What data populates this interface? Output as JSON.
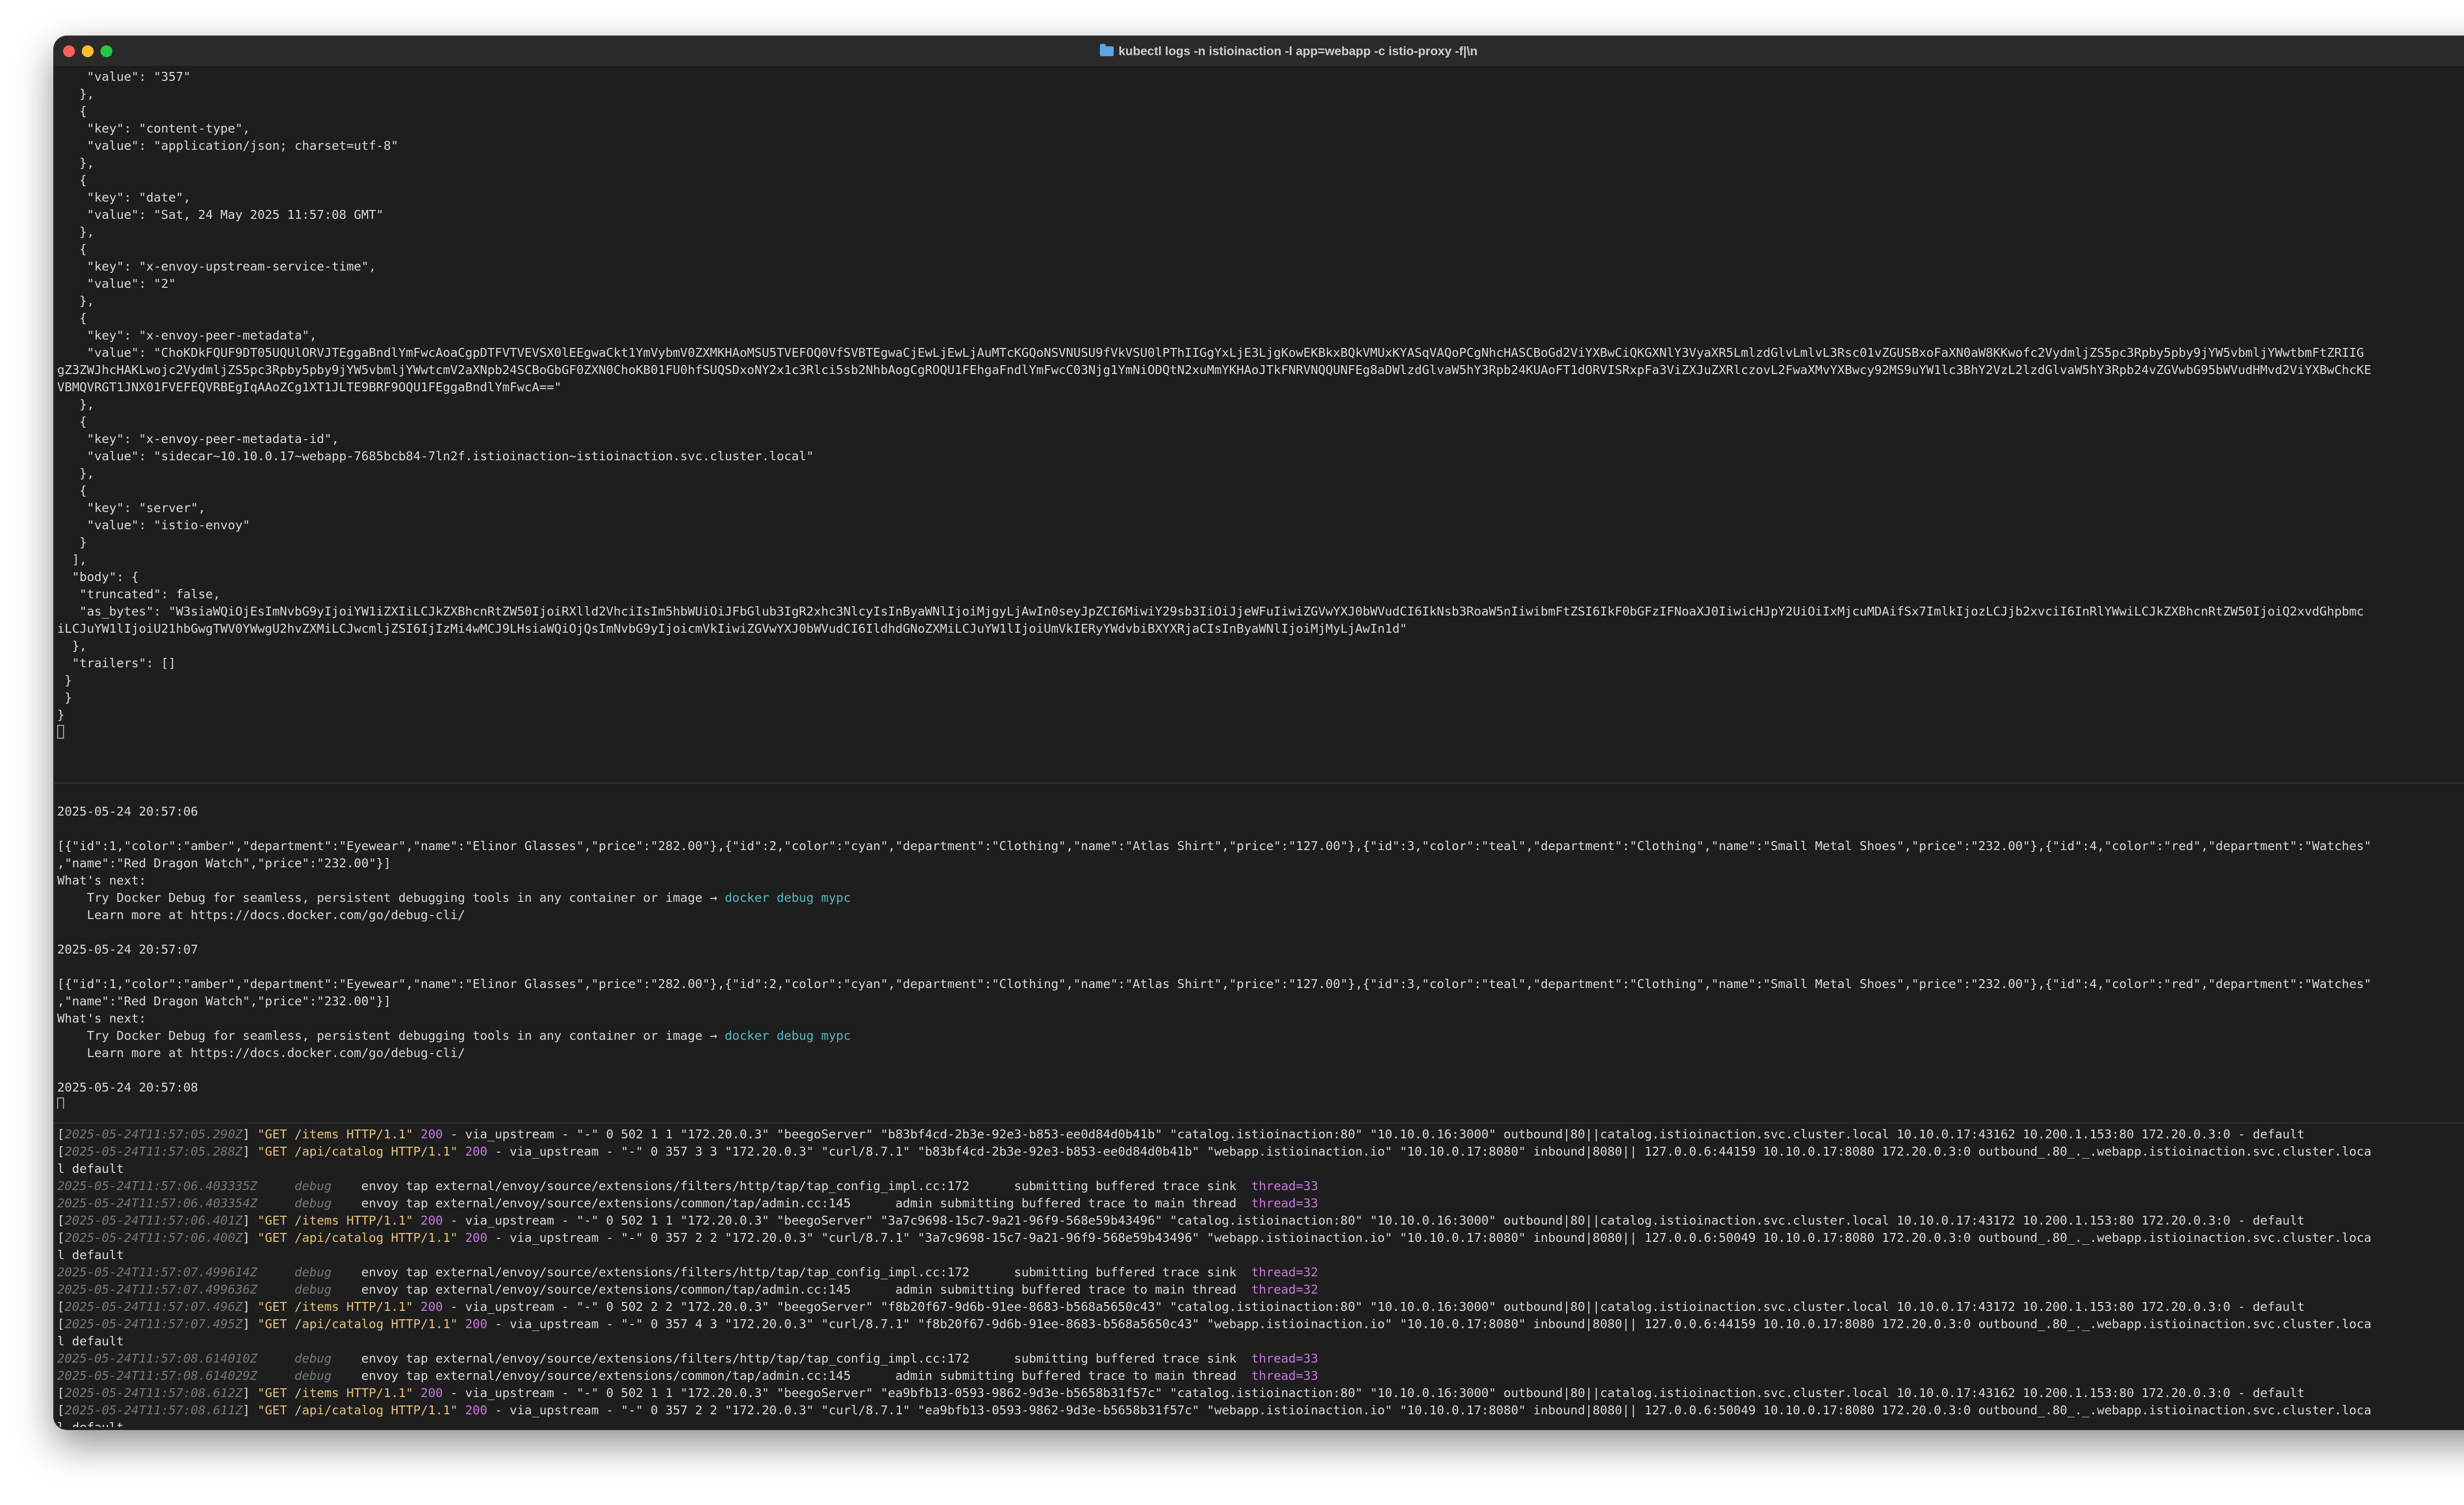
{
  "window": {
    "title": "kubectl logs -n istioinaction -l app=webapp -c istio-proxy -f|\\n",
    "icon": "folder-icon"
  },
  "json_output_lines": [
    "    \"value\": \"357\"",
    "   },",
    "   {",
    "    \"key\": \"content-type\",",
    "    \"value\": \"application/json; charset=utf-8\"",
    "   },",
    "   {",
    "    \"key\": \"date\",",
    "    \"value\": \"Sat, 24 May 2025 11:57:08 GMT\"",
    "   },",
    "   {",
    "    \"key\": \"x-envoy-upstream-service-time\",",
    "    \"value\": \"2\"",
    "   },",
    "   {",
    "    \"key\": \"x-envoy-peer-metadata\",",
    "    \"value\": \"ChoKDkFQUF9DT05UQUlORVJTEggaBndlYmFwcAoaCgpDTFVTVEVSX0lEEgwaCkt1YmVybmV0ZXMKHAoMSU5TVEFOQ0VfSVBTEgwaCjEwLjEwLjAuMTcKGQoNSVNUSU9fVkVSU0lPThIIGgYxLjE3LjgKowEKBkxBQkVMUxKYASqVAQoPCgNhcHASCBoGd2ViYXBwCiQKGXNlY3VyaXR5LmlzdGlvLmlvL3Rsc01vZGUSBxoFaXN0aW8KKwofc2VydmljZS5pc3Rpby5pby9jYW5vbmljYWwtbmFtZRIIG",
    "gZ3ZWJhcHAKLwojc2VydmljZS5pc3Rpby5pby9jYW5vbmljYWwtcmV2aXNpb24SCBoGbGF0ZXN0ChoKB01FU0hfSUQSDxoNY2x1c3Rlci5sb2NhbAogCgROQU1FEhgaFndlYmFwcC03Njg1YmNiODQtN2xuMmYKHAoJTkFNRVNQQUNFEg8aDWlzdGlvaW5hY3Rpb24KUAoFT1dORVISRxpFa3ViZXJuZXRlczovL2FwaXMvYXBwcy92MS9uYW1lc3BhY2VzL2lzdGlvaW5hY3Rpb24vZGVwbG95bWVudHMvd2ViYXBwChcKE",
    "VBMQVRGT1JNX01FVEFEQVRBEgIqAAoZCg1XT1JLTE9BRF9OQU1FEggaBndlYmFwcA==\"",
    "   },",
    "   {",
    "    \"key\": \"x-envoy-peer-metadata-id\",",
    "    \"value\": \"sidecar~10.10.0.17~webapp-7685bcb84-7ln2f.istioinaction~istioinaction.svc.cluster.local\"",
    "   },",
    "   {",
    "    \"key\": \"server\",",
    "    \"value\": \"istio-envoy\"",
    "   }",
    "  ],",
    "  \"body\": {",
    "   \"truncated\": false,",
    "   \"as_bytes\": \"W3siaWQiOjEsImNvbG9yIjoiYW1iZXIiLCJkZXBhcnRtZW50IjoiRXlld2VhciIsIm5hbWUiOiJFbGlub3IgR2xhc3NlcyIsInByaWNlIjoiMjgyLjAwIn0seyJpZCI6MiwiY29sb3IiOiJjeWFuIiwiZGVwYXJ0bWVudCI6IkNsb3RoaW5nIiwibmFtZSI6IkF0bGFzIFNoaXJ0IiwicHJpY2UiOiIxMjcuMDAifSx7ImlkIjozLCJjb2xvciI6InRlYWwiLCJkZXBhcnRtZW50IjoiQ2xvdGhpbmc",
    "iLCJuYW1lIjoiU21hbGwgTWV0YWwgU2hvZXMiLCJwcmljZSI6IjIzMi4wMCJ9LHsiaWQiOjQsImNvbG9yIjoicmVkIiwiZGVwYXJ0bWVudCI6IldhdGNoZXMiLCJuYW1lIjoiUmVkIERyYWdvbiBXYXRjaCIsInByaWNlIjoiMjMyLjAwIn1d\"",
    "  },",
    "  \"trailers\": []",
    " }",
    " }",
    "}"
  ],
  "curl_pane": {
    "blocks": [
      {
        "timestamp": "2025-05-24 20:57:06",
        "response_line1": "[{\"id\":1,\"color\":\"amber\",\"department\":\"Eyewear\",\"name\":\"Elinor Glasses\",\"price\":\"282.00\"},{\"id\":2,\"color\":\"cyan\",\"department\":\"Clothing\",\"name\":\"Atlas Shirt\",\"price\":\"127.00\"},{\"id\":3,\"color\":\"teal\",\"department\":\"Clothing\",\"name\":\"Small Metal Shoes\",\"price\":\"232.00\"},{\"id\":4,\"color\":\"red\",\"department\":\"Watches\"",
        "response_line2": ",\"name\":\"Red Dragon Watch\",\"price\":\"232.00\"}]",
        "whats_next": "What's next:",
        "tip": "    Try Docker Debug for seamless, persistent debugging tools in any container or image → ",
        "tip_cmd": "docker debug mypc",
        "learn": "    Learn more at https://docs.docker.com/go/debug-cli/"
      },
      {
        "timestamp": "2025-05-24 20:57:07",
        "response_line1": "[{\"id\":1,\"color\":\"amber\",\"department\":\"Eyewear\",\"name\":\"Elinor Glasses\",\"price\":\"282.00\"},{\"id\":2,\"color\":\"cyan\",\"department\":\"Clothing\",\"name\":\"Atlas Shirt\",\"price\":\"127.00\"},{\"id\":3,\"color\":\"teal\",\"department\":\"Clothing\",\"name\":\"Small Metal Shoes\",\"price\":\"232.00\"},{\"id\":4,\"color\":\"red\",\"department\":\"Watches\"",
        "response_line2": ",\"name\":\"Red Dragon Watch\",\"price\":\"232.00\"}]",
        "whats_next": "What's next:",
        "tip": "    Try Docker Debug for seamless, persistent debugging tools in any container or image → ",
        "tip_cmd": "docker debug mypc",
        "learn": "    Learn more at https://docs.docker.com/go/debug-cli/"
      }
    ],
    "last_timestamp": "2025-05-24 20:57:08"
  },
  "log_pane": {
    "lines": [
      {
        "kind": "access",
        "ts": "2025-05-24T11:57:05.290Z",
        "req": "\"GET /items HTTP/1.1\"",
        "status": "200",
        "rest": " - via_upstream - \"-\" 0 502 1 1 \"172.20.0.3\" \"beegoServer\" \"b83bf4cd-2b3e-92e3-b853-ee0d84d0b41b\" \"catalog.istioinaction:80\" \"10.10.0.16:3000\" outbound|80||catalog.istioinaction.svc.cluster.local 10.10.0.17:43162 10.200.1.153:80 172.20.0.3:0 - default"
      },
      {
        "kind": "access",
        "ts": "2025-05-24T11:57:05.288Z",
        "req": "\"GET /api/catalog HTTP/1.1\"",
        "status": "200",
        "rest": " - via_upstream - \"-\" 0 357 3 3 \"172.20.0.3\" \"curl/8.7.1\" \"b83bf4cd-2b3e-92e3-b853-ee0d84d0b41b\" \"webapp.istioinaction.io\" \"10.10.0.17:8080\" inbound|8080|| 127.0.0.6:44159 10.10.0.17:8080 172.20.0.3:0 outbound_.80_._.webapp.istioinaction.svc.cluster.loca"
      },
      {
        "kind": "cont",
        "text": "l default"
      },
      {
        "kind": "debug",
        "ts": "2025-05-24T11:57:06.403335Z",
        "level": "debug",
        "msg": "envoy tap external/envoy/source/extensions/filters/http/tap/tap_config_impl.cc:172      submitting buffered trace sink  ",
        "thread": "thread=33"
      },
      {
        "kind": "debug",
        "ts": "2025-05-24T11:57:06.403354Z",
        "level": "debug",
        "msg": "envoy tap external/envoy/source/extensions/common/tap/admin.cc:145      admin submitting buffered trace to main thread  ",
        "thread": "thread=33"
      },
      {
        "kind": "access",
        "ts": "2025-05-24T11:57:06.401Z",
        "req": "\"GET /items HTTP/1.1\"",
        "status": "200",
        "rest": " - via_upstream - \"-\" 0 502 1 1 \"172.20.0.3\" \"beegoServer\" \"3a7c9698-15c7-9a21-96f9-568e59b43496\" \"catalog.istioinaction:80\" \"10.10.0.16:3000\" outbound|80||catalog.istioinaction.svc.cluster.local 10.10.0.17:43172 10.200.1.153:80 172.20.0.3:0 - default"
      },
      {
        "kind": "access",
        "ts": "2025-05-24T11:57:06.400Z",
        "req": "\"GET /api/catalog HTTP/1.1\"",
        "status": "200",
        "rest": " - via_upstream - \"-\" 0 357 2 2 \"172.20.0.3\" \"curl/8.7.1\" \"3a7c9698-15c7-9a21-96f9-568e59b43496\" \"webapp.istioinaction.io\" \"10.10.0.17:8080\" inbound|8080|| 127.0.0.6:50049 10.10.0.17:8080 172.20.0.3:0 outbound_.80_._.webapp.istioinaction.svc.cluster.loca"
      },
      {
        "kind": "cont",
        "text": "l default"
      },
      {
        "kind": "debug",
        "ts": "2025-05-24T11:57:07.499614Z",
        "level": "debug",
        "msg": "envoy tap external/envoy/source/extensions/filters/http/tap/tap_config_impl.cc:172      submitting buffered trace sink  ",
        "thread": "thread=32"
      },
      {
        "kind": "debug",
        "ts": "2025-05-24T11:57:07.499636Z",
        "level": "debug",
        "msg": "envoy tap external/envoy/source/extensions/common/tap/admin.cc:145      admin submitting buffered trace to main thread  ",
        "thread": "thread=32"
      },
      {
        "kind": "access",
        "ts": "2025-05-24T11:57:07.496Z",
        "req": "\"GET /items HTTP/1.1\"",
        "status": "200",
        "rest": " - via_upstream - \"-\" 0 502 2 2 \"172.20.0.3\" \"beegoServer\" \"f8b20f67-9d6b-91ee-8683-b568a5650c43\" \"catalog.istioinaction:80\" \"10.10.0.16:3000\" outbound|80||catalog.istioinaction.svc.cluster.local 10.10.0.17:43172 10.200.1.153:80 172.20.0.3:0 - default"
      },
      {
        "kind": "access",
        "ts": "2025-05-24T11:57:07.495Z",
        "req": "\"GET /api/catalog HTTP/1.1\"",
        "status": "200",
        "rest": " - via_upstream - \"-\" 0 357 4 3 \"172.20.0.3\" \"curl/8.7.1\" \"f8b20f67-9d6b-91ee-8683-b568a5650c43\" \"webapp.istioinaction.io\" \"10.10.0.17:8080\" inbound|8080|| 127.0.0.6:44159 10.10.0.17:8080 172.20.0.3:0 outbound_.80_._.webapp.istioinaction.svc.cluster.loca"
      },
      {
        "kind": "cont",
        "text": "l default"
      },
      {
        "kind": "debug",
        "ts": "2025-05-24T11:57:08.614010Z",
        "level": "debug",
        "msg": "envoy tap external/envoy/source/extensions/filters/http/tap/tap_config_impl.cc:172      submitting buffered trace sink  ",
        "thread": "thread=33"
      },
      {
        "kind": "debug",
        "ts": "2025-05-24T11:57:08.614029Z",
        "level": "debug",
        "msg": "envoy tap external/envoy/source/extensions/common/tap/admin.cc:145      admin submitting buffered trace to main thread  ",
        "thread": "thread=33"
      },
      {
        "kind": "access",
        "ts": "2025-05-24T11:57:08.612Z",
        "req": "\"GET /items HTTP/1.1\"",
        "status": "200",
        "rest": " - via_upstream - \"-\" 0 502 1 1 \"172.20.0.3\" \"beegoServer\" \"ea9bfb13-0593-9862-9d3e-b5658b31f57c\" \"catalog.istioinaction:80\" \"10.10.0.16:3000\" outbound|80||catalog.istioinaction.svc.cluster.local 10.10.0.17:43162 10.200.1.153:80 172.20.0.3:0 - default"
      },
      {
        "kind": "access",
        "ts": "2025-05-24T11:57:08.611Z",
        "req": "\"GET /api/catalog HTTP/1.1\"",
        "status": "200",
        "rest": " - via_upstream - \"-\" 0 357 2 2 \"172.20.0.3\" \"curl/8.7.1\" \"ea9bfb13-0593-9862-9d3e-b5658b31f57c\" \"webapp.istioinaction.io\" \"10.10.0.17:8080\" inbound|8080|| 127.0.0.6:50049 10.10.0.17:8080 172.20.0.3:0 outbound_.80_._.webapp.istioinaction.svc.cluster.loca"
      },
      {
        "kind": "cont",
        "text": "l default"
      }
    ]
  },
  "colors": {
    "background": "#1e1e1e",
    "text": "#d8d8d8",
    "timestamp": "#777777",
    "request": "#e5c07b",
    "status": "#c678dd",
    "link": "#56b6c2"
  }
}
